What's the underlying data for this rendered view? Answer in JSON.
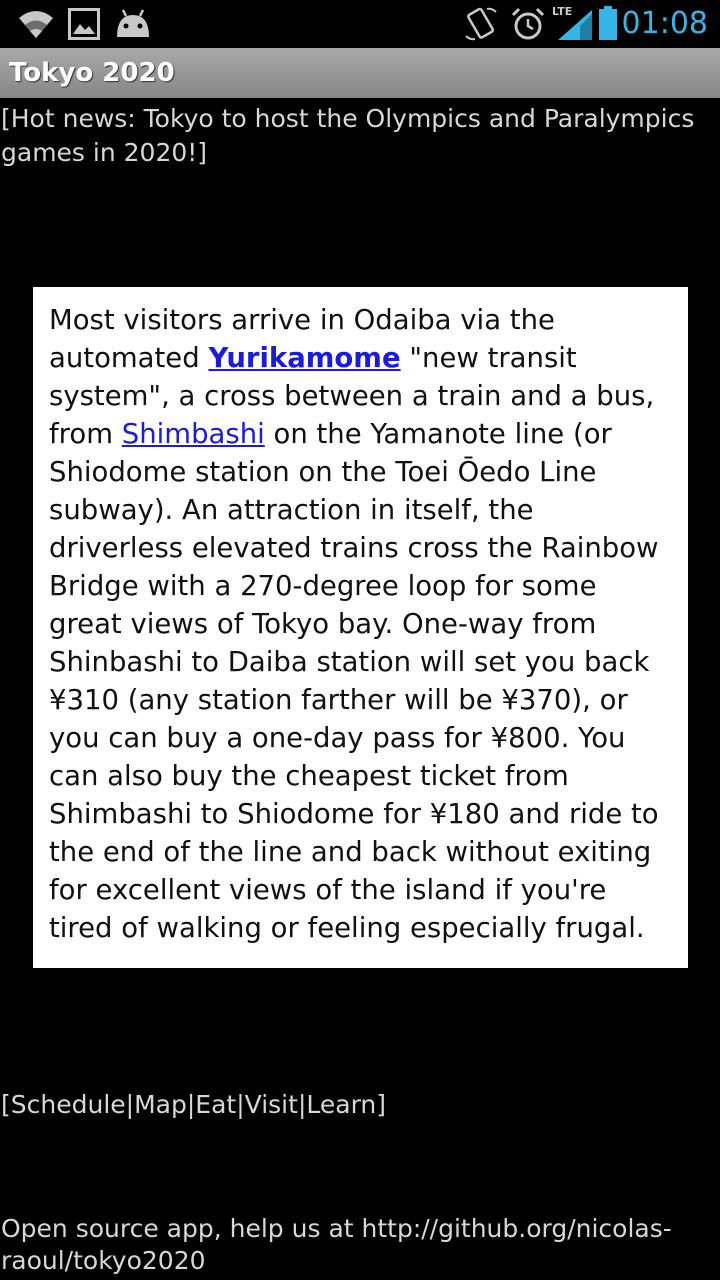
{
  "status_bar": {
    "time": "01:08",
    "network_label": "LTE",
    "accent_color": "#33b5e5",
    "icons": [
      "wifi-icon",
      "gallery-icon",
      "android-debug-icon",
      "rotate-icon",
      "alarm-icon",
      "signal-icon",
      "battery-icon"
    ]
  },
  "app": {
    "title": "Tokyo 2020"
  },
  "news": {
    "text": "[Hot news: Tokyo to host the Olympics and Paralympics games in 2020!]"
  },
  "article": {
    "p1": "Most visitors arrive in Odaiba via the automated ",
    "link1": "Yurikamome",
    "p2": " \"new transit system\", a cross between a train and a bus, from ",
    "link2": "Shimbashi",
    "p3": " on the Yamanote line (or Shiodome station on the Toei Ōedo Line subway). An attraction in itself, the driverless elevated trains cross the Rainbow Bridge with a 270-degree loop for some great views of Tokyo bay. One-way from Shinbashi to Daiba station will set you back ¥310 (any station farther will be ¥370), or you can buy a one-day pass for ¥800. You can also buy the cheapest ticket from Shimbashi to Shiodome for ¥180 and ride to the end of the line and back without exiting for excellent views of the island if you're tired of walking or feeling especially frugal."
  },
  "nav": {
    "open": "[",
    "sep": "|",
    "close": "]",
    "items": [
      "Schedule",
      "Map",
      "Eat",
      "Visit",
      "Learn"
    ]
  },
  "footer": {
    "text": "Open source app, help us at http://github.org/nicolas-raoul/tokyo2020"
  }
}
